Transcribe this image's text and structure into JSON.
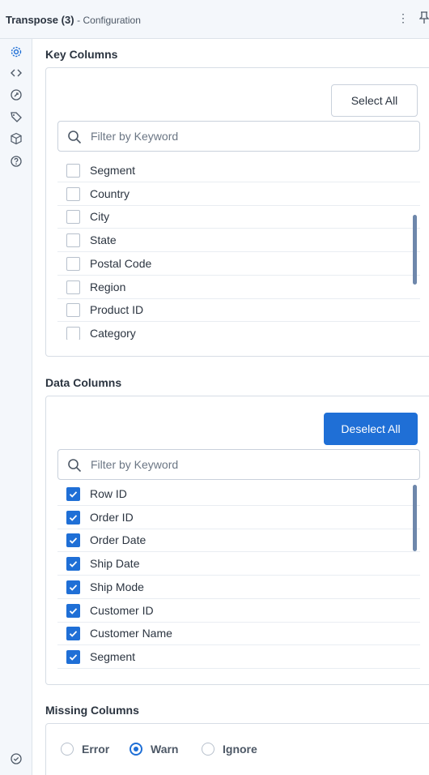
{
  "header": {
    "title": "Transpose (3)",
    "subtitle": "- Configuration",
    "menu_icon": "kebab-menu-icon",
    "pin_icon": "pin-icon"
  },
  "rail": {
    "icons": [
      "gear-icon",
      "code-icon",
      "tool-icon",
      "tag-icon",
      "cube-icon",
      "help-icon"
    ],
    "bottom_icon": "check-circle-icon"
  },
  "key_columns": {
    "title": "Key Columns",
    "select_all_label": "Select All",
    "search_placeholder": "Filter by Keyword",
    "items": [
      {
        "label": "Segment",
        "checked": false
      },
      {
        "label": "Country",
        "checked": false
      },
      {
        "label": "City",
        "checked": false
      },
      {
        "label": "State",
        "checked": false
      },
      {
        "label": "Postal Code",
        "checked": false
      },
      {
        "label": "Region",
        "checked": false
      },
      {
        "label": "Product ID",
        "checked": false
      },
      {
        "label": "Category",
        "checked": false
      }
    ]
  },
  "data_columns": {
    "title": "Data Columns",
    "deselect_all_label": "Deselect All",
    "search_placeholder": "Filter by Keyword",
    "items": [
      {
        "label": "Row ID",
        "checked": true
      },
      {
        "label": "Order ID",
        "checked": true
      },
      {
        "label": "Order Date",
        "checked": true
      },
      {
        "label": "Ship Date",
        "checked": true
      },
      {
        "label": "Ship Mode",
        "checked": true
      },
      {
        "label": "Customer ID",
        "checked": true
      },
      {
        "label": "Customer Name",
        "checked": true
      },
      {
        "label": "Segment",
        "checked": true
      }
    ]
  },
  "missing_columns": {
    "title": "Missing Columns",
    "options": [
      {
        "label": "Error",
        "selected": false
      },
      {
        "label": "Warn",
        "selected": true
      },
      {
        "label": "Ignore",
        "selected": false
      }
    ]
  },
  "colors": {
    "accent": "#1f6fd6",
    "scrollbar": "#6e87ab",
    "panel_bg": "#f4f7fb"
  }
}
